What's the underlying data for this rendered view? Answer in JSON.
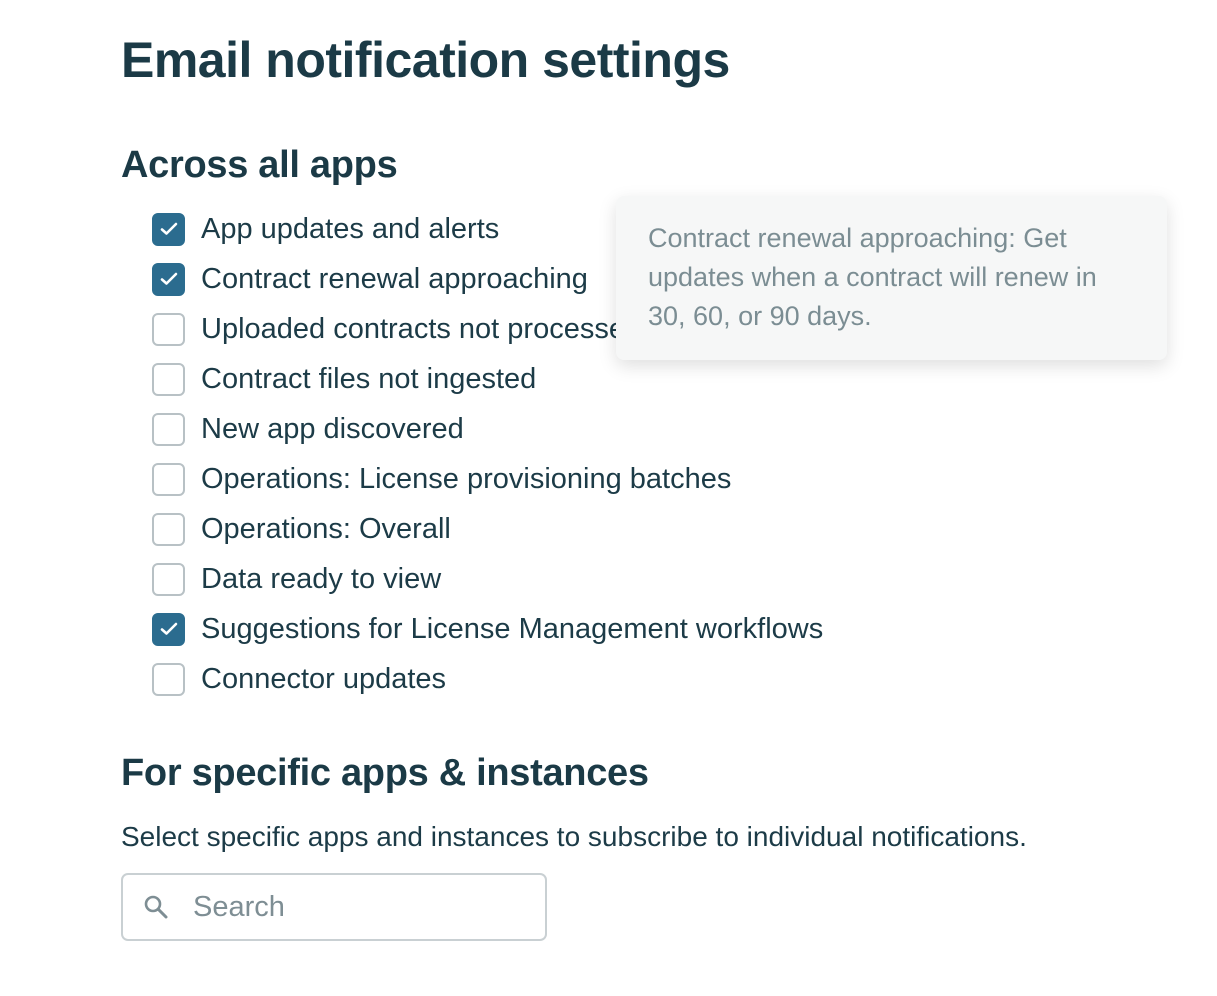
{
  "page": {
    "title": "Email notification settings"
  },
  "across_all_apps": {
    "heading": "Across all apps",
    "options": [
      {
        "label": "App updates and alerts",
        "checked": true
      },
      {
        "label": "Contract renewal approaching",
        "checked": true
      },
      {
        "label": "Uploaded contracts not processed",
        "checked": false
      },
      {
        "label": "Contract files not ingested",
        "checked": false
      },
      {
        "label": "New app discovered",
        "checked": false
      },
      {
        "label": "Operations: License provisioning batches",
        "checked": false
      },
      {
        "label": "Operations: Overall",
        "checked": false
      },
      {
        "label": "Data ready to view",
        "checked": false
      },
      {
        "label": "Suggestions for License Management workflows",
        "checked": true
      },
      {
        "label": "Connector updates",
        "checked": false
      }
    ]
  },
  "tooltip": {
    "text": "Contract renewal approaching: Get updates when a contract will renew in 30, 60, or 90 days."
  },
  "specific_apps": {
    "heading": "For specific apps & instances",
    "description": "Select specific apps and instances to subscribe to individual notifications.",
    "search": {
      "placeholder": "Search",
      "value": "",
      "icon": "search-icon"
    }
  },
  "colors": {
    "text": "#1c3b47",
    "checkbox_checked": "#2b6c8f",
    "checkbox_border": "#b8c1c5",
    "tooltip_bg": "#f6f7f7",
    "tooltip_text": "#7b8d93"
  }
}
